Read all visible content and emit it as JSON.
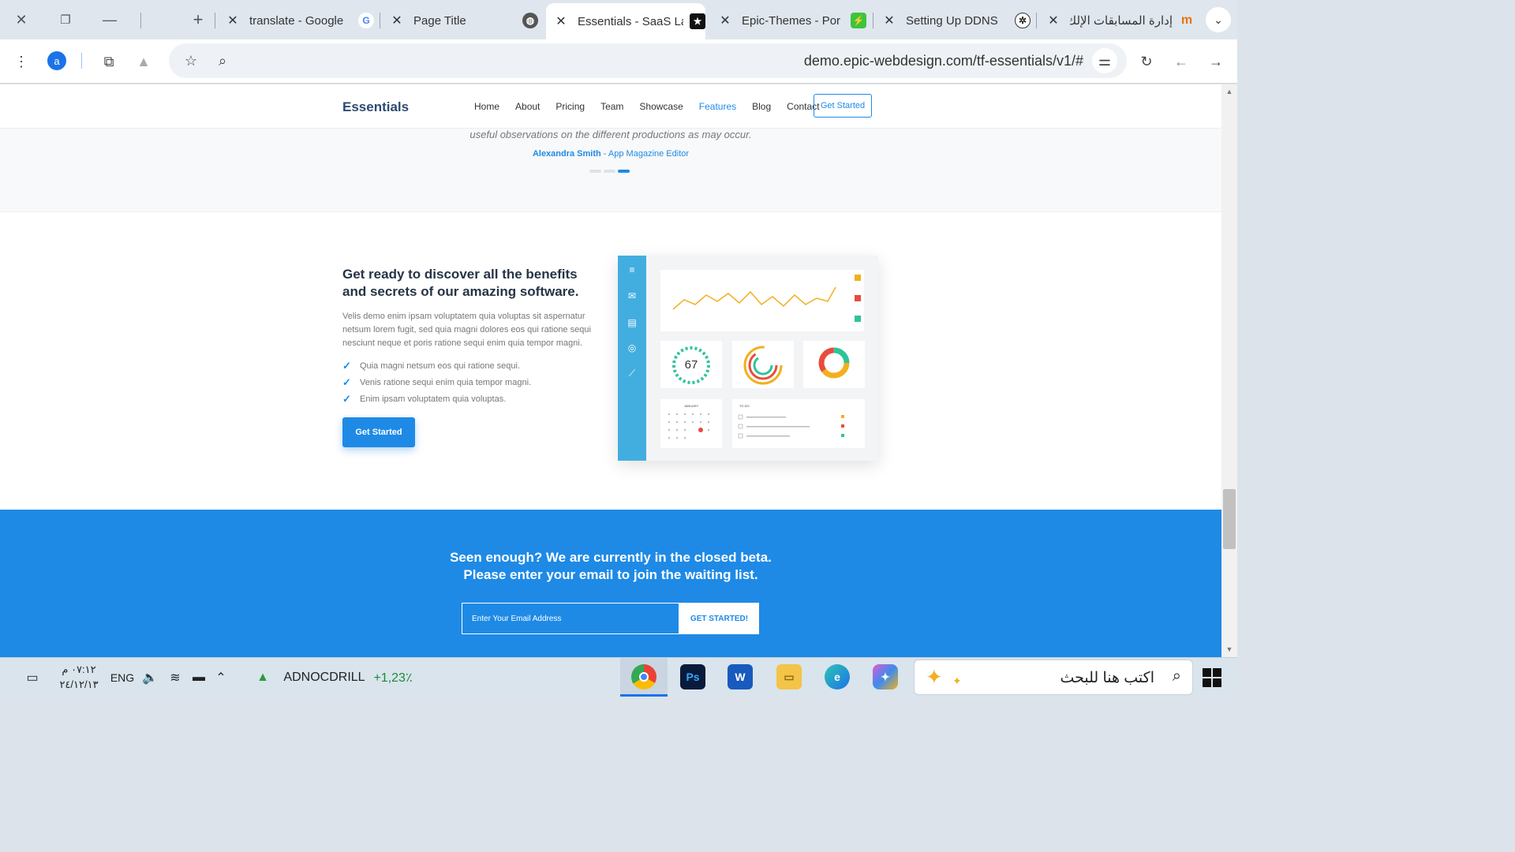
{
  "browser": {
    "tabs": [
      {
        "title": "translate - Google",
        "favicon": "G",
        "active": false
      },
      {
        "title": "Page Title",
        "favicon": "globe",
        "active": false
      },
      {
        "title": "Essentials - SaaS La",
        "favicon": "★",
        "active": true
      },
      {
        "title": "Epic-Themes - Por",
        "favicon": "bolt",
        "active": false
      },
      {
        "title": "Setting Up DDNS",
        "favicon": "openai",
        "active": false
      },
      {
        "title": "إدارة المسابقات الإلك",
        "favicon": "m",
        "active": false
      }
    ],
    "profile_initial": "a",
    "url": "demo.epic-webdesign.com/tf-essentials/v1/#"
  },
  "site": {
    "logo": "Essentials",
    "nav": [
      "Home",
      "About",
      "Pricing",
      "Team",
      "Showcase",
      "Features",
      "Blog",
      "Contact"
    ],
    "nav_active": "Features",
    "nav_cta": "Get Started",
    "testimonial": {
      "quote": "useful observations on the different productions as may occur.",
      "author": "Alexandra Smith",
      "role": " - App Magazine Editor"
    },
    "feature": {
      "title": "Get ready to discover all the benefits and secrets of our amazing software.",
      "text": "Velis demo enim ipsam voluptatem quia voluptas sit aspernatur netsum lorem fugit, sed quia magni dolores eos qui ratione sequi nesciunt neque et poris ratione sequi enim quia tempor magni.",
      "checks": [
        "Quia magni netsum eos qui ratione sequi.",
        "Venis ratione sequi enim quia tempor magni.",
        "Enim ipsam voluptatem quia voluptas."
      ],
      "button": "Get Started",
      "dashboard": {
        "gauge_value": "67",
        "calendar_month": "JANUARY",
        "todo_title": "TO DO"
      }
    },
    "cta": {
      "line1": "Seen enough? We are currently in the closed beta.",
      "line2": "Please enter your email to join the waiting list.",
      "email_placeholder": "Enter Your Email Address",
      "button": "GET STARTED!"
    }
  },
  "taskbar": {
    "time": "٠٧:١٢ م",
    "date": "٢٤/١٢/١٣",
    "lang": "ENG",
    "stock_name": "ADNOCDRILL",
    "stock_change": "+1,23٪",
    "search_placeholder": "اكتب هنا للبحث"
  },
  "colors": {
    "accent": "#1e8ae6",
    "sidebar": "#42aee0",
    "heading": "#263445"
  }
}
